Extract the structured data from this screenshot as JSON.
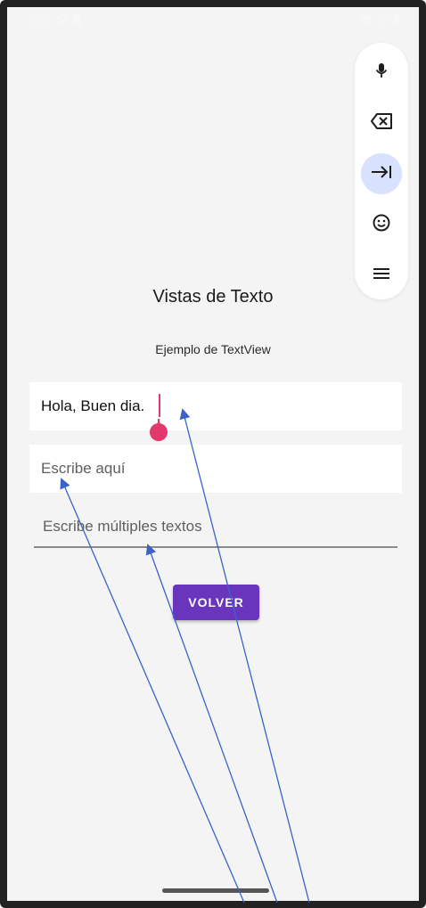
{
  "status_bar": {
    "time": "5:46",
    "icons": [
      "do-not-disturb-icon",
      "sim-card-icon",
      "wifi-icon",
      "signal-icon",
      "battery-icon"
    ]
  },
  "keyboard_toolbar": {
    "buttons": [
      {
        "icon": "microphone-icon"
      },
      {
        "icon": "backspace-icon"
      },
      {
        "icon": "tab-arrow-icon",
        "active": true
      },
      {
        "icon": "emoji-icon"
      },
      {
        "icon": "menu-icon"
      }
    ]
  },
  "screen": {
    "title": "Vistas de Texto",
    "subtitle": "Ejemplo de TextView",
    "text_input": {
      "value": "Hola, Buen dia."
    },
    "single_line_input": {
      "placeholder": "Escribe aquí"
    },
    "multi_line_input": {
      "placeholder": "Escribe múltiples textos"
    },
    "back_button": {
      "label": "VOLVER"
    }
  },
  "colors": {
    "background": "#f4f4f4",
    "button": "#6a35bd",
    "cursor": "#e2396d",
    "toolbar_active": "#d8e2ff",
    "annotation_arrow": "#3a63c8"
  }
}
